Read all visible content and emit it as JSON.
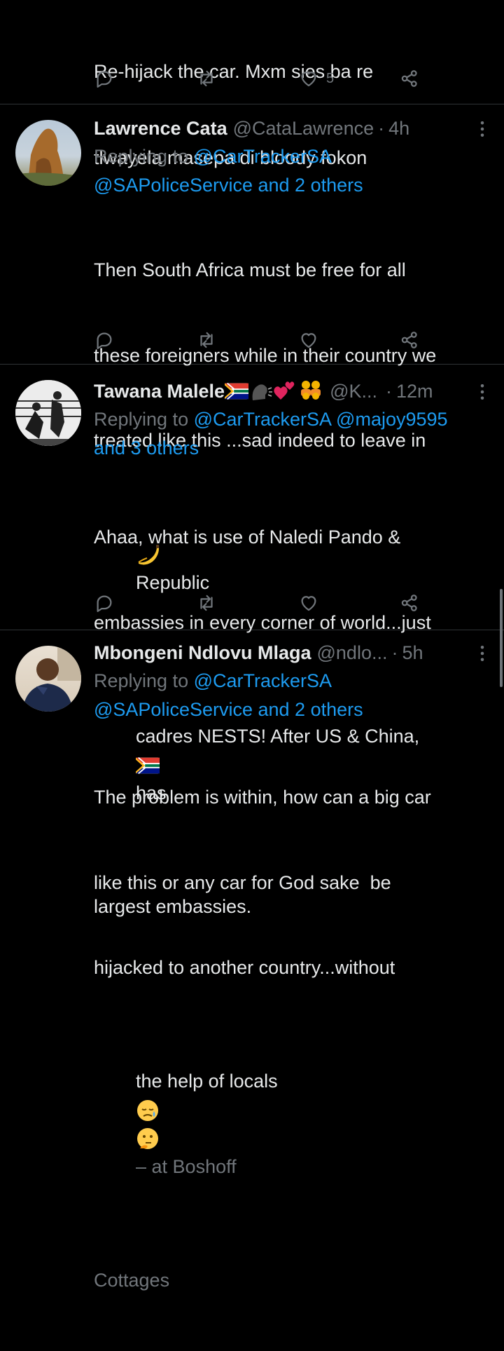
{
  "tweets": [
    {
      "text_lines": [
        "Re-hijack the car. Mxm sies ba re",
        "tlwayela masepa di bloody fokon"
      ],
      "like_count": "5"
    },
    {
      "name": "Lawrence Cata",
      "handle": "@CataLawrence",
      "time": "4h",
      "replying_prefix": "Replying to ",
      "replying_link1": "@CarTrackerSA",
      "replying_link2": "@SAPoliceService and 2 others",
      "text_lines": [
        "Then South Africa must be free for all",
        "these foreigners while in their country we",
        "treated like this ...sad indeed to leave in"
      ],
      "last_line": "Republic"
    },
    {
      "name": "Tawana Malele",
      "handle": "@K...",
      "time": "12m",
      "replying_prefix": "Replying to ",
      "replying_link1": "@CarTrackerSA @majoy9595",
      "replying_link2": "and 3 others",
      "text_lines": [
        "Ahaa, what is use of Naledi Pando &",
        "embassies in every corner of world...just"
      ],
      "line3_start": "cadres NESTS! After US & China,",
      "line3_end": "has",
      "line4": "largest embassies."
    },
    {
      "name": "Mbongeni Ndlovu Mlaga",
      "handle": "@ndlo...",
      "time": "5h",
      "replying_prefix": "Replying to ",
      "replying_link1": "@CarTrackerSA",
      "replying_link2": "@SAPoliceService and 2 others",
      "text_lines": [
        "The problem is within, how can a big car",
        "like this or any car for God sake  be",
        "hijacked to another country...without"
      ],
      "line4_start": "the help of locals",
      "location_prefix": "– at Boshoff",
      "location_end": "Cottages"
    }
  ],
  "separator_dot": "·",
  "colors": {
    "link": "#1d9bf0",
    "muted": "#71767b",
    "text": "#e7e9ea",
    "background": "#000000"
  },
  "icons": [
    "reply-icon",
    "retweet-icon",
    "like-icon",
    "share-icon",
    "more-icon"
  ]
}
